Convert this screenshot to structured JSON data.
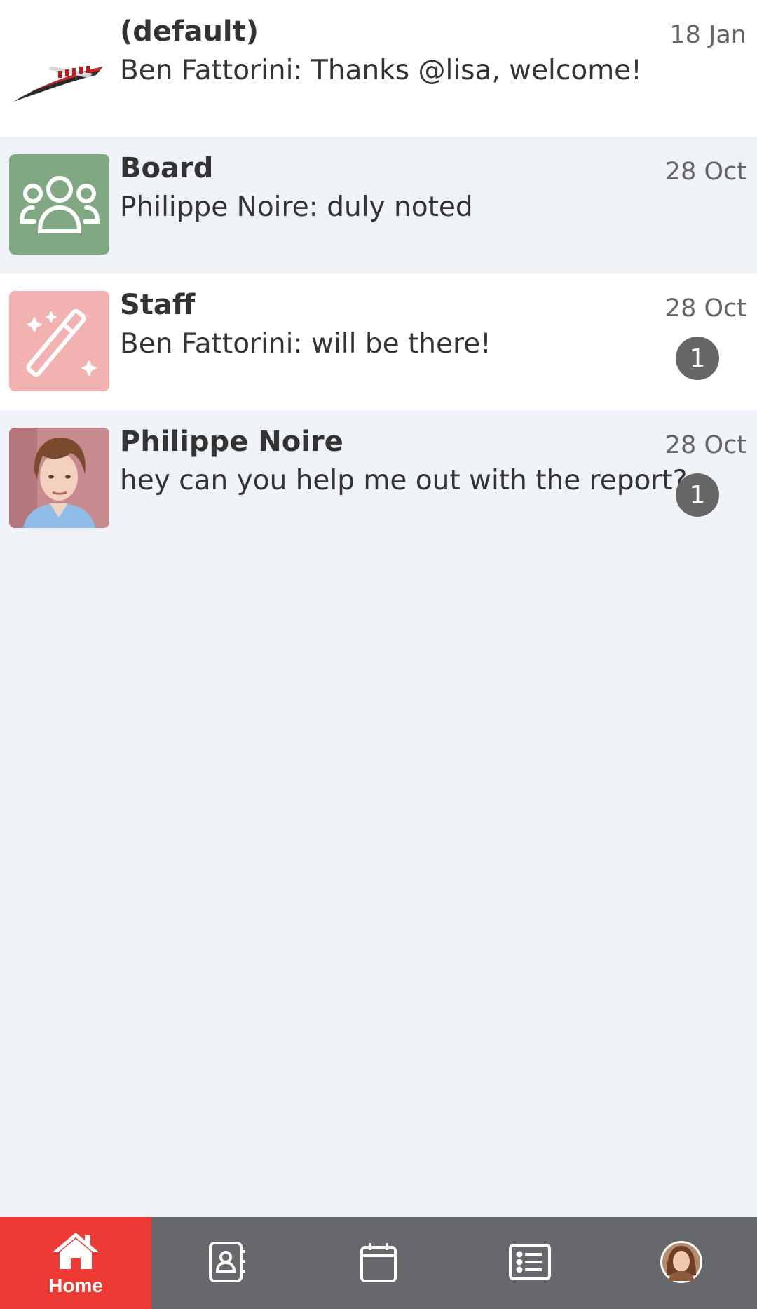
{
  "conversations": [
    {
      "title": "(default)",
      "preview": "Ben Fattorini: Thanks @lisa, welcome!",
      "date": "18 Jan",
      "avatar": "shuttle-logo-icon"
    },
    {
      "title": "Board",
      "preview": "Philippe Noire: duly noted",
      "date": "28 Oct",
      "avatar": "group-icon",
      "avatar_color": "#80a882"
    },
    {
      "title": "Staff",
      "preview": "Ben Fattorini: will be there!",
      "date": "28 Oct",
      "unread": "1",
      "avatar": "magic-wand-icon",
      "avatar_color": "#f3b2b2"
    },
    {
      "title": "Philippe Noire",
      "preview": "hey can you help me out with the report?",
      "date": "28 Oct",
      "unread": "1",
      "avatar": "user-photo"
    }
  ],
  "nav": {
    "home_label": "Home",
    "active_color": "#ee3a34",
    "bar_color": "#67686b",
    "items": [
      "home-icon",
      "contacts-icon",
      "calendar-icon",
      "list-icon",
      "profile-avatar"
    ]
  }
}
